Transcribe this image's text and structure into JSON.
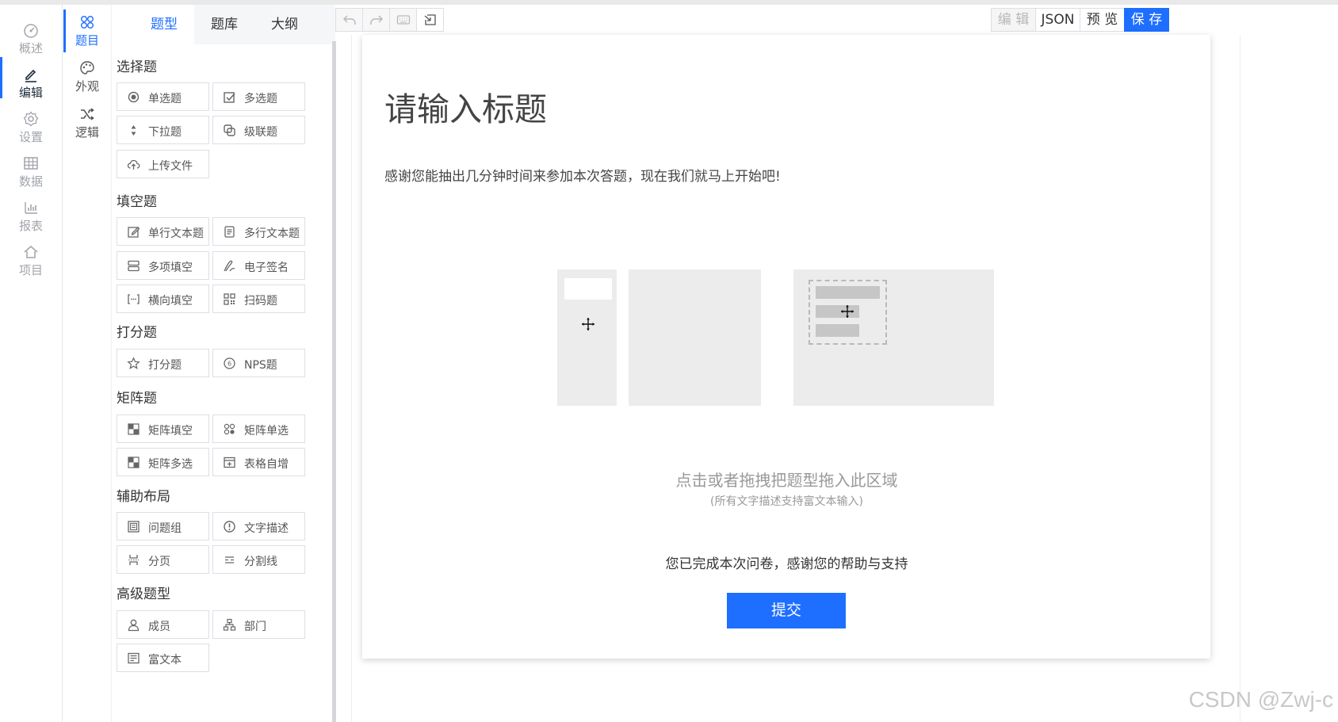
{
  "colors": {
    "accent": "#1e6fff",
    "rail_inactive": "#a0a4aa",
    "placeholder_bg": "#ececec"
  },
  "rail": {
    "items": [
      {
        "label": "概述",
        "icon": "dashboard-icon"
      },
      {
        "label": "编辑",
        "icon": "edit-pen-icon",
        "active": true
      },
      {
        "label": "设置",
        "icon": "gear-icon"
      },
      {
        "label": "数据",
        "icon": "table-icon"
      },
      {
        "label": "报表",
        "icon": "bar-chart-icon"
      },
      {
        "label": "项目",
        "icon": "home-icon"
      }
    ]
  },
  "rail2": {
    "items": [
      {
        "label": "题目",
        "icon": "flower-icon",
        "active": true
      },
      {
        "label": "外观",
        "icon": "palette-icon"
      },
      {
        "label": "逻辑",
        "icon": "shuffle-icon"
      }
    ]
  },
  "tabs": [
    {
      "label": "题型",
      "active": true
    },
    {
      "label": "题库"
    },
    {
      "label": "大纲"
    }
  ],
  "groups": {
    "choice": {
      "title": "选择题",
      "items": [
        "单选题",
        "多选题",
        "下拉题",
        "级联题",
        "上传文件"
      ]
    },
    "fill": {
      "title": "填空题",
      "items": [
        "单行文本题",
        "多行文本题",
        "多项填空",
        "电子签名",
        "横向填空",
        "扫码题"
      ]
    },
    "score": {
      "title": "打分题",
      "items": [
        "打分题",
        "NPS题"
      ]
    },
    "matrix": {
      "title": "矩阵题",
      "items": [
        "矩阵填空",
        "矩阵单选",
        "矩阵多选",
        "表格自增"
      ]
    },
    "layout": {
      "title": "辅助布局",
      "items": [
        "问题组",
        "文字描述",
        "分页",
        "分割线"
      ]
    },
    "advanced": {
      "title": "高级题型",
      "items": [
        "成员",
        "部门",
        "富文本"
      ]
    }
  },
  "toolbar": {
    "edit_label": "编 辑",
    "json_label": "JSON",
    "preview_label": "预 览",
    "save_label": "保 存"
  },
  "survey": {
    "title": "请输入标题",
    "description": "感谢您能抽出几分钟时间来参加本次答题，现在我们就马上开始吧!",
    "drop_hint": "点击或者拖拽把题型拖入此区域",
    "drop_sub": "(所有文字描述支持富文本输入)",
    "end_text": "您已完成本次问卷，感谢您的帮助与支持",
    "submit_label": "提交"
  },
  "watermark": "CSDN @Zwj-c"
}
